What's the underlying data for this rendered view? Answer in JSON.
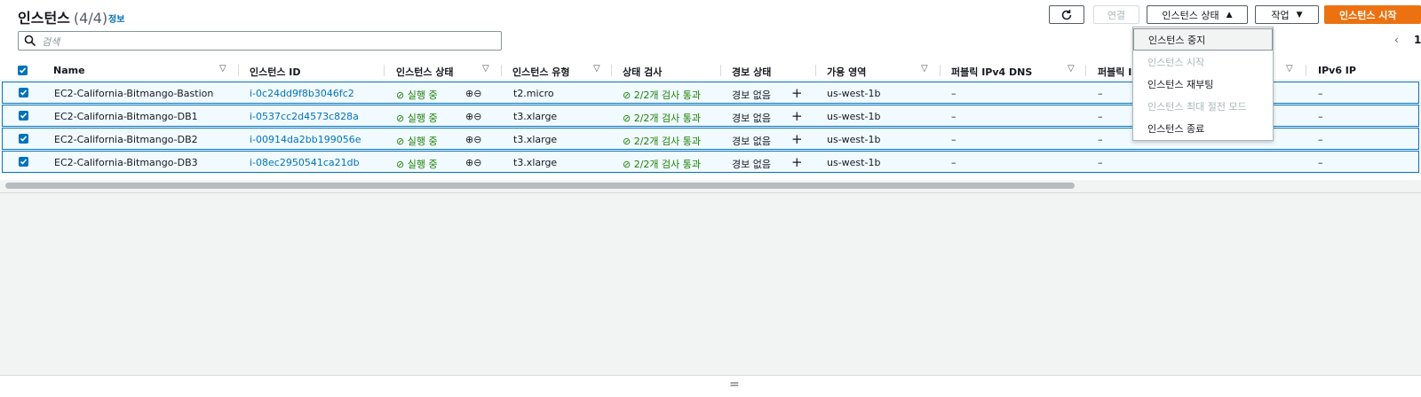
{
  "header": {
    "title": "인스턴스",
    "count": "(4/4)",
    "info": "정보",
    "search_placeholder": "검색"
  },
  "toolbar": {
    "connect": "연결",
    "instance_state": "인스턴스 상태",
    "actions": "작업",
    "launch": "인스턴스 시작"
  },
  "pager": {
    "page": "1"
  },
  "columns": [
    "Name",
    "인스턴스 ID",
    "인스턴스 상태",
    "인스턴스 유형",
    "상태 검사",
    "경보 상태",
    "가용 영역",
    "퍼블릭 IPv4 DNS",
    "퍼블릭 IPv4 ...",
    "IPv6 IP"
  ],
  "rows": [
    {
      "name": "EC2-California-Bitmango-Bastion",
      "id": "i-0c24dd9f8b3046fc2",
      "state": "실행 중",
      "type": "t2.micro",
      "check": "2/2개 검사 통과",
      "alarm": "경보 없음",
      "az": "us-west-1b",
      "dns": "–",
      "ip": "–",
      "ipv6": "–"
    },
    {
      "name": "EC2-California-Bitmango-DB1",
      "id": "i-0537cc2d4573c828a",
      "state": "실행 중",
      "type": "t3.xlarge",
      "check": "2/2개 검사 통과",
      "alarm": "경보 없음",
      "az": "us-west-1b",
      "dns": "–",
      "ip": "–",
      "ipv6": "–"
    },
    {
      "name": "EC2-California-Bitmango-DB2",
      "id": "i-00914da2bb199056e",
      "state": "실행 중",
      "type": "t3.xlarge",
      "check": "2/2개 검사 통과",
      "alarm": "경보 없음",
      "az": "us-west-1b",
      "dns": "–",
      "ip": "–",
      "ipv6": "–"
    },
    {
      "name": "EC2-California-Bitmango-DB3",
      "id": "i-08ec2950541ca21db",
      "state": "실행 중",
      "type": "t3.xlarge",
      "check": "2/2개 검사 통과",
      "alarm": "경보 없음",
      "az": "us-west-1b",
      "dns": "–",
      "ip": "–",
      "ipv6": "–"
    }
  ],
  "menu": [
    {
      "label": "인스턴스 중지",
      "state": "highlighted"
    },
    {
      "label": "인스턴스 시작",
      "state": "disabled"
    },
    {
      "label": "인스턴스 재부팅",
      "state": "enabled"
    },
    {
      "label": "인스턴스 최대 절전 모드",
      "state": "disabled"
    },
    {
      "label": "인스턴스 종료",
      "state": "enabled"
    }
  ],
  "colors": {
    "accent": "#0073bb",
    "primary": "#ec7211",
    "success": "#1d8102"
  }
}
